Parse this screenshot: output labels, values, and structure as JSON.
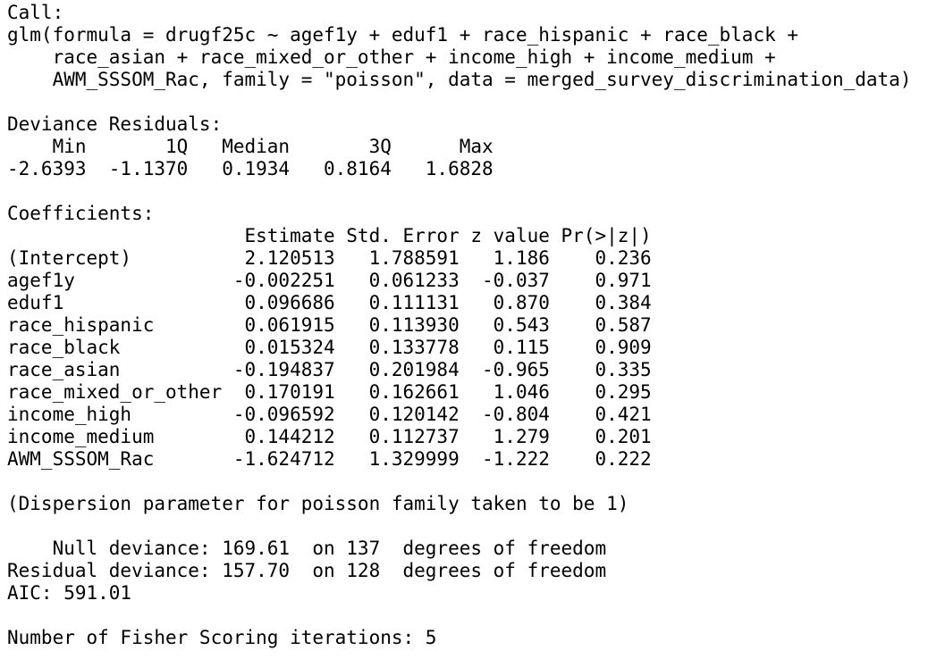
{
  "call": {
    "header": "Call:",
    "lines": [
      "glm(formula = drugf25c ~ agef1y + eduf1 + race_hispanic + race_black + ",
      "    race_asian + race_mixed_or_other + income_high + income_medium + ",
      "    AWM_SSSOM_Rac, family = \"poisson\", data = merged_survey_discrimination_data)"
    ]
  },
  "deviance_residuals": {
    "header": "Deviance Residuals: ",
    "labels_line": "    Min       1Q   Median       3Q      Max  ",
    "values_line": "-2.6393  -1.1370   0.1934   0.8164   1.6828  "
  },
  "coefficients": {
    "header": "Coefficients:",
    "column_header": "                     Estimate Std. Error z value Pr(>|z|)",
    "rows": [
      "(Intercept)          2.120513   1.788591   1.186    0.236",
      "agef1y              -0.002251   0.061233  -0.037    0.971",
      "eduf1                0.096686   0.111131   0.870    0.384",
      "race_hispanic        0.061915   0.113930   0.543    0.587",
      "race_black           0.015324   0.133778   0.115    0.909",
      "race_asian          -0.194837   0.201984  -0.965    0.335",
      "race_mixed_or_other  0.170191   0.162661   1.046    0.295",
      "income_high         -0.096592   0.120142  -0.804    0.421",
      "income_medium        0.144212   0.112737   1.279    0.201",
      "AWM_SSSOM_Rac       -1.624712   1.329999  -1.222    0.222"
    ]
  },
  "dispersion_note": "(Dispersion parameter for poisson family taken to be 1)",
  "deviance": {
    "null_line": "    Null deviance: 169.61  on 137  degrees of freedom",
    "residual_line": "Residual deviance: 157.70  on 128  degrees of freedom",
    "aic_line": "AIC: 591.01"
  },
  "fisher_iterations": "Number of Fisher Scoring iterations: 5"
}
